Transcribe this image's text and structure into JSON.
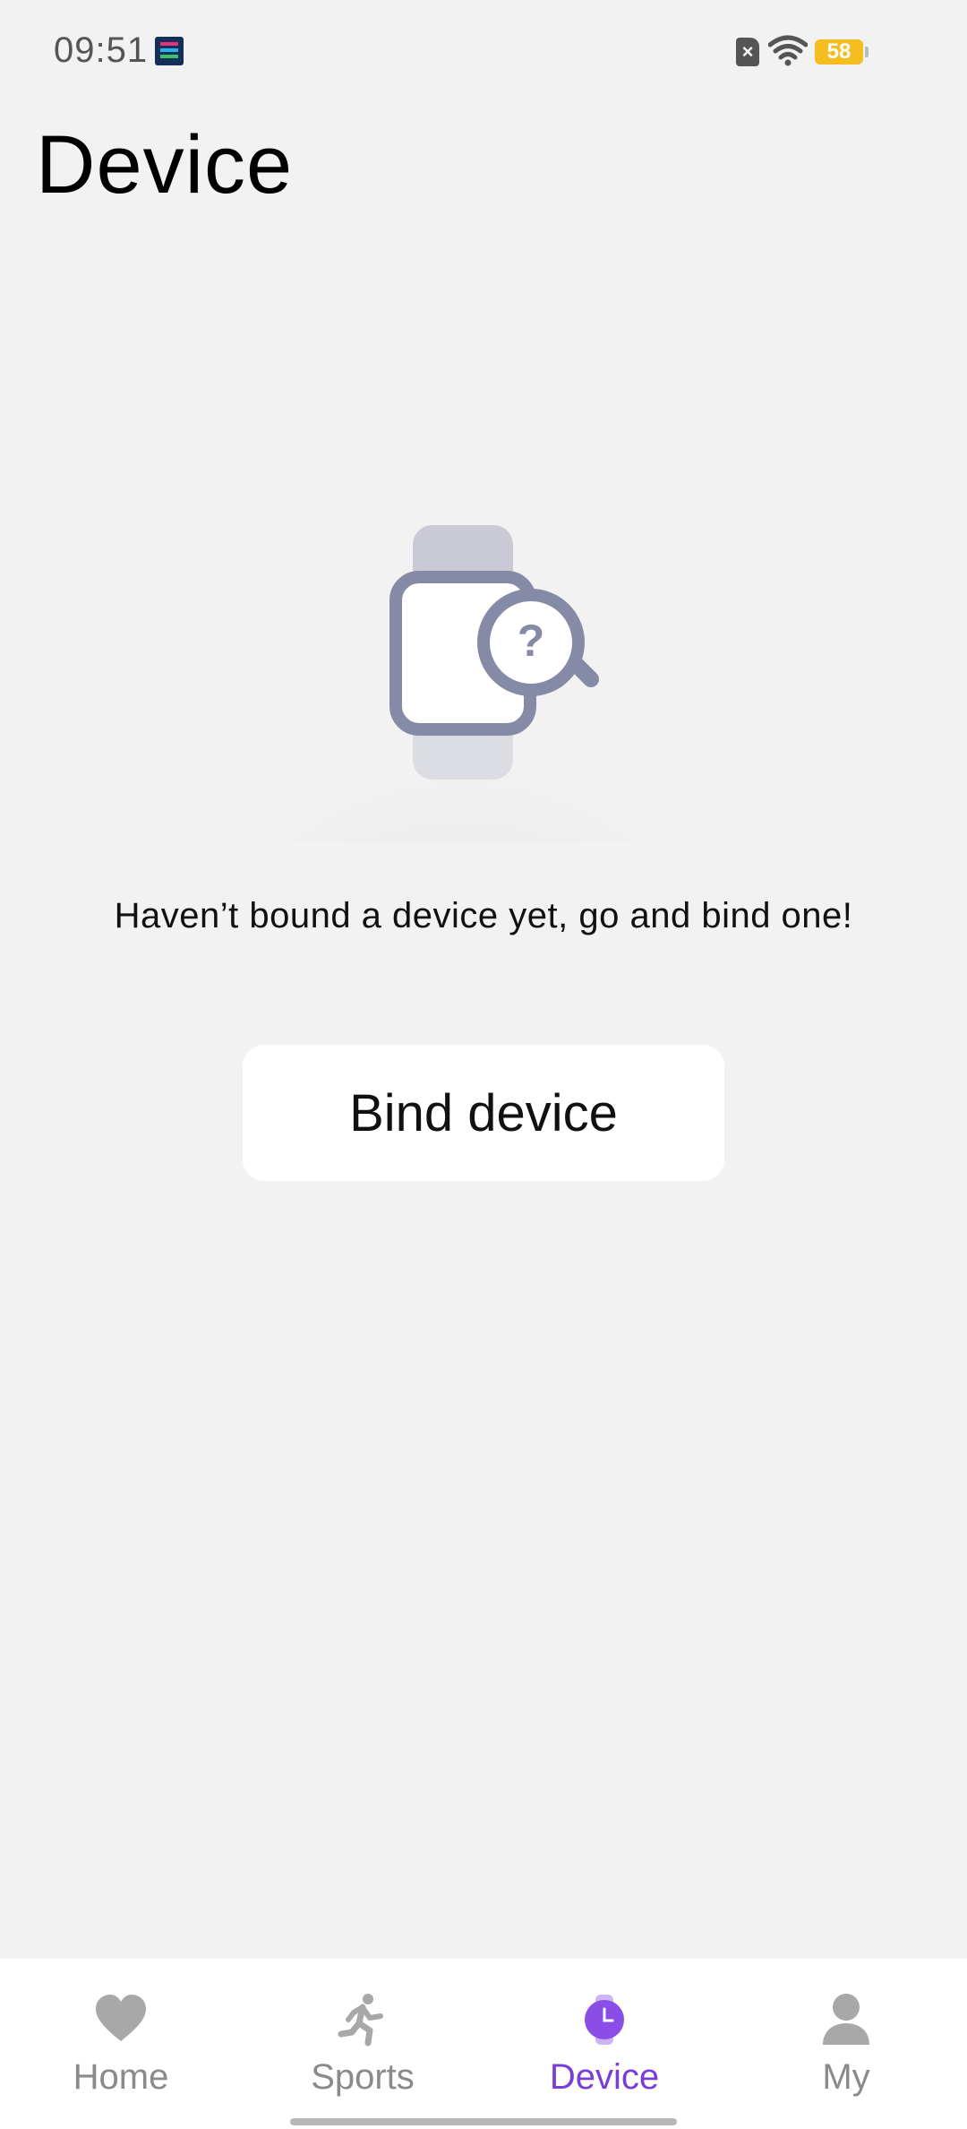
{
  "status_bar": {
    "time": "09:51",
    "notification_icon": "app-notification-icon",
    "sim_icon": "sim-off-icon",
    "wifi_icon": "wifi-icon",
    "battery_level": "58",
    "battery_color": "#f5bd1f"
  },
  "page": {
    "title": "Device"
  },
  "empty_state": {
    "illustration_icon": "watch-search-icon",
    "message": "Haven’t bound a device yet, go and bind one!",
    "button_label": "Bind device"
  },
  "tab_bar": {
    "active_color": "#7a3ed6",
    "inactive_color": "#8a8a8a",
    "tabs": [
      {
        "label": "Home",
        "icon": "heart-icon",
        "active": false
      },
      {
        "label": "Sports",
        "icon": "running-icon",
        "active": false
      },
      {
        "label": "Device",
        "icon": "watch-icon",
        "active": true
      },
      {
        "label": "My",
        "icon": "person-icon",
        "active": false
      }
    ]
  }
}
